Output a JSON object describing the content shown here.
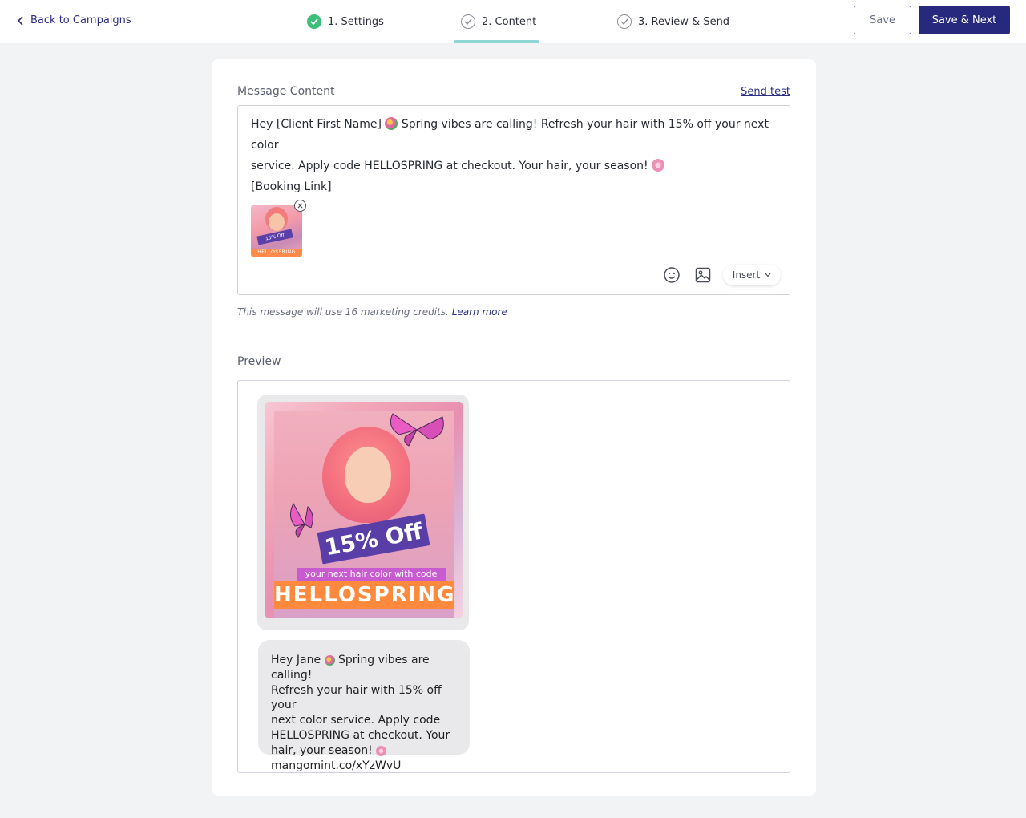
{
  "header": {
    "back_label": "Back to Campaigns",
    "steps": [
      {
        "label": "1. Settings",
        "state": "done"
      },
      {
        "label": "2. Content",
        "state": "active"
      },
      {
        "label": "3. Review & Send",
        "state": "todo"
      }
    ],
    "save_label": "Save",
    "save_next_label": "Save & Next"
  },
  "content": {
    "section_label": "Message Content",
    "send_test_label": "Send test",
    "message_line1_a": "Hey [Client First Name]",
    "message_line1_b": "Spring vibes are calling! Refresh your hair with 15% off your next color",
    "message_line2": "service. Apply code HELLOSPRING at checkout. Your hair, your season!",
    "message_line3": "[Booking Link]",
    "attachment": {
      "badge_text": "15% Off",
      "code_text": "HELLOSPRING"
    },
    "insert_label": "Insert",
    "credits_text": "This message will use 16 marketing credits.",
    "learn_more_label": "Learn more"
  },
  "preview": {
    "section_label": "Preview",
    "image": {
      "badge_text": "15% Off",
      "tag_text": "your next hair color with code",
      "code_text": "HELLOSPRING"
    },
    "line1_a": "Hey Jane",
    "line1_b": "Spring vibes are calling!",
    "line2": "Refresh your hair with 15% off your",
    "line3": "next color service. Apply code",
    "line4": "HELLOSPRING at checkout. Your",
    "line5": "hair, your season!",
    "line6": "mangomint.co/xYzWvU"
  },
  "colors": {
    "brand": "#27297f",
    "step_done": "#3cc079",
    "active_underline": "#8fd6d6"
  }
}
